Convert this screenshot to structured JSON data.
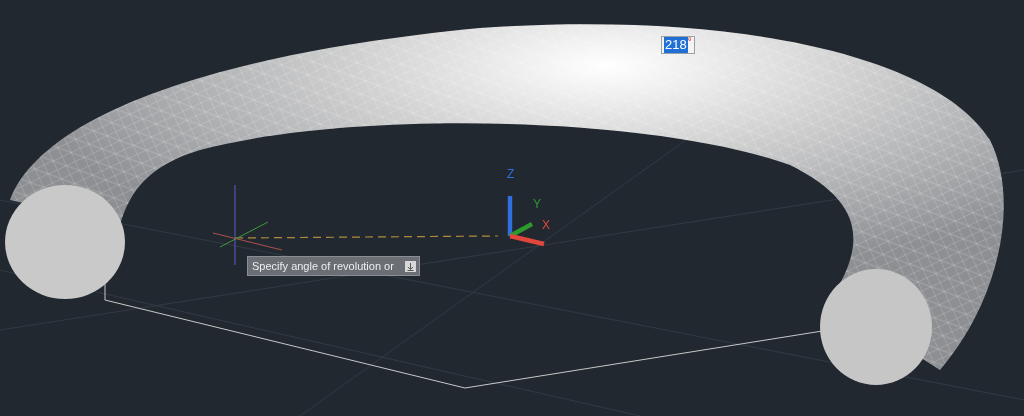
{
  "angle_input": {
    "value": "218",
    "unit": "°"
  },
  "prompt": {
    "text": "Specify angle of revolution or"
  },
  "ucs_axes": [
    {
      "label": "Z",
      "color": "#2f6fe0"
    },
    {
      "label": "Y",
      "color": "#2e9a2e"
    },
    {
      "label": "X",
      "color": "#e0463c"
    }
  ]
}
